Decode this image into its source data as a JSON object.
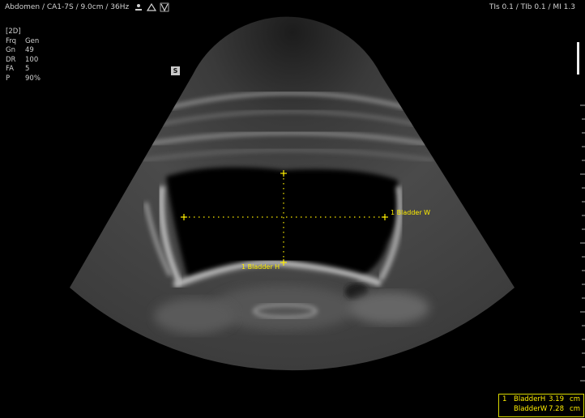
{
  "header": {
    "exam_info": "Abdomen / CA1-7S / 9.0cm / 36Hz",
    "indices": "TIs  0.1 / TIb  0.1 / MI    1.3"
  },
  "params": [
    {
      "key": "[2D]",
      "value": ""
    },
    {
      "key": "Frq",
      "value": "Gen"
    },
    {
      "key": "Gn",
      "value": "49"
    },
    {
      "key": "DR",
      "value": "100"
    },
    {
      "key": "FA",
      "value": "5"
    },
    {
      "key": "P",
      "value": "90%"
    }
  ],
  "marker": "S",
  "labels": {
    "width": "1 Bladder W",
    "height": "1 Bladder H"
  },
  "measurements": [
    {
      "num": "1",
      "name": "BladderH",
      "value": "3.19",
      "unit": "cm"
    },
    {
      "num": "",
      "name": "BladderW",
      "value": "7.28",
      "unit": "cm"
    }
  ],
  "colors": {
    "caliper": "#ffee00",
    "text": "#d0d0d0"
  }
}
